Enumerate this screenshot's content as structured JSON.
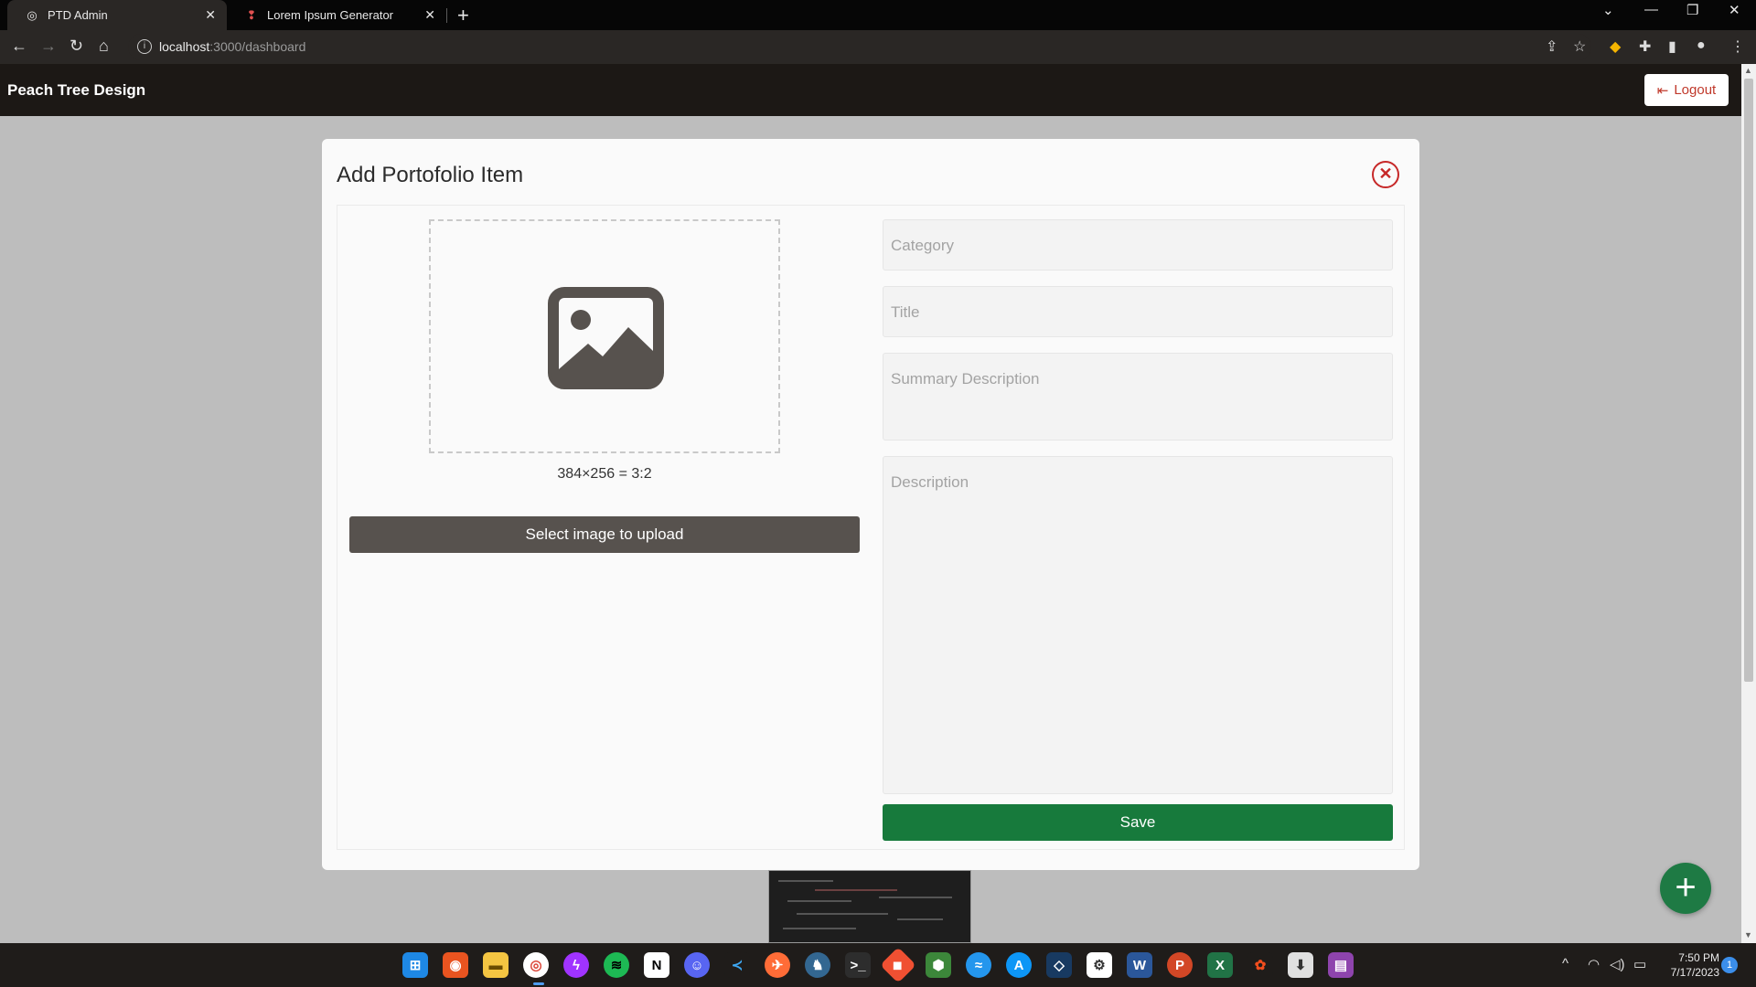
{
  "browser": {
    "tabs": [
      {
        "title": "PTD Admin",
        "active": true
      },
      {
        "title": "Lorem Ipsum Generator",
        "active": false
      }
    ],
    "new_tab": "+",
    "url_host": "localhost",
    "url_path": ":3000/dashboard"
  },
  "app": {
    "brand": "Peach Tree Design",
    "logout_label": "Logout"
  },
  "modal": {
    "title": "Add Portofolio Item",
    "image_ratio_text": "384×256 = 3:2",
    "select_image_label": "Select image to upload",
    "fields": {
      "category_placeholder": "Category",
      "title_placeholder": "Title",
      "summary_placeholder": "Summary Description",
      "description_placeholder": "Description"
    },
    "save_label": "Save"
  },
  "fab": {
    "label": "+",
    "color": "#1e7a44"
  },
  "taskbar": {
    "apps": [
      "windows-start",
      "ubuntu",
      "file-explorer",
      "chrome",
      "messenger",
      "spotify",
      "notion",
      "discord",
      "vscode",
      "postman",
      "postgres",
      "terminal",
      "git",
      "node",
      "docker",
      "app-store",
      "virtualbox",
      "settings",
      "word",
      "powerpoint",
      "excel",
      "figma",
      "installer",
      "clapper"
    ],
    "time": "7:50 PM",
    "date": "7/17/2023",
    "notifications": "1"
  },
  "colors": {
    "header_bg": "#1c1815",
    "save_green": "#177a3c",
    "upload_btn": "#57524e",
    "danger": "#c62828"
  }
}
